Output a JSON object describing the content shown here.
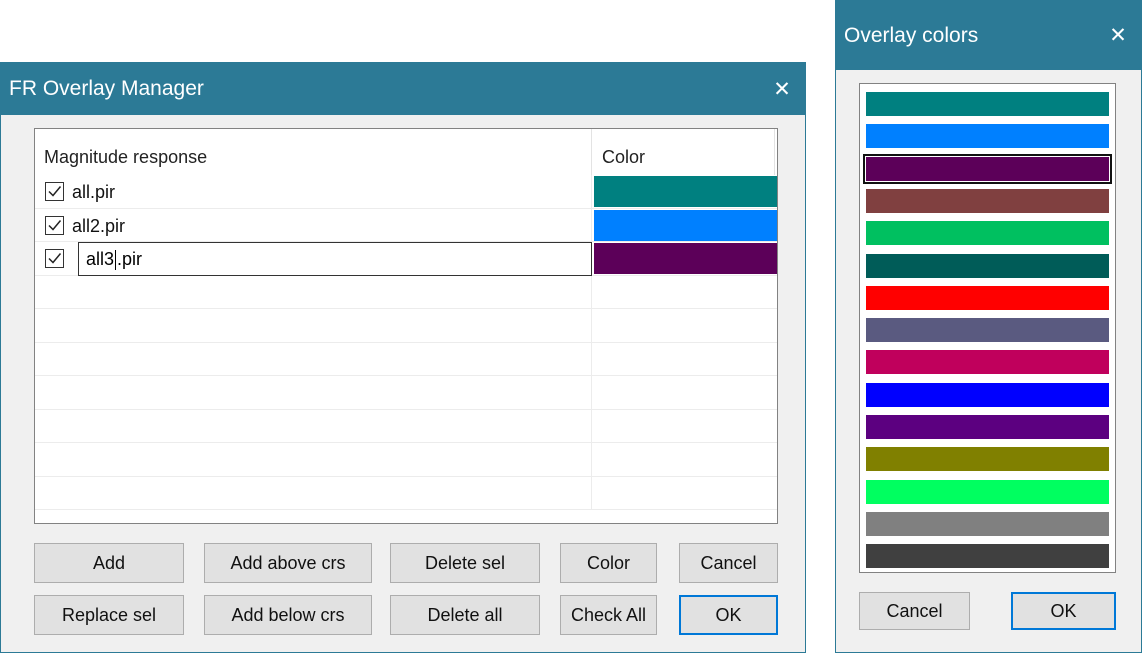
{
  "fr_dialog": {
    "title": "FR Overlay Manager",
    "close_glyph": "✕",
    "list": {
      "col_name": "Magnitude response",
      "col_color": "Color",
      "items": [
        {
          "name": "all.pir",
          "checked": true,
          "color": "#008080"
        },
        {
          "name": "all2.pir",
          "checked": true,
          "color": "#0080ff"
        },
        {
          "name_before_caret": "all3",
          "name_after_caret": ".pir",
          "checked": true,
          "color": "#5c0059",
          "editing": true
        }
      ]
    },
    "buttons": {
      "add": "Add",
      "add_above": "Add above crs",
      "delete_sel": "Delete sel",
      "color": "Color",
      "cancel": "Cancel",
      "replace_sel": "Replace sel",
      "add_below": "Add below crs",
      "delete_all": "Delete all",
      "check_all": "Check All",
      "ok": "OK"
    }
  },
  "colors_dialog": {
    "title": "Overlay colors",
    "close_glyph": "✕",
    "colors": [
      "#008080",
      "#0080ff",
      "#5c0059",
      "#804040",
      "#00c060",
      "#005c58",
      "#ff0000",
      "#5a5a80",
      "#c0005c",
      "#0000ff",
      "#5c0080",
      "#808000",
      "#00ff60",
      "#808080",
      "#404040"
    ],
    "selected_index": 2,
    "buttons": {
      "cancel": "Cancel",
      "ok": "OK"
    }
  }
}
